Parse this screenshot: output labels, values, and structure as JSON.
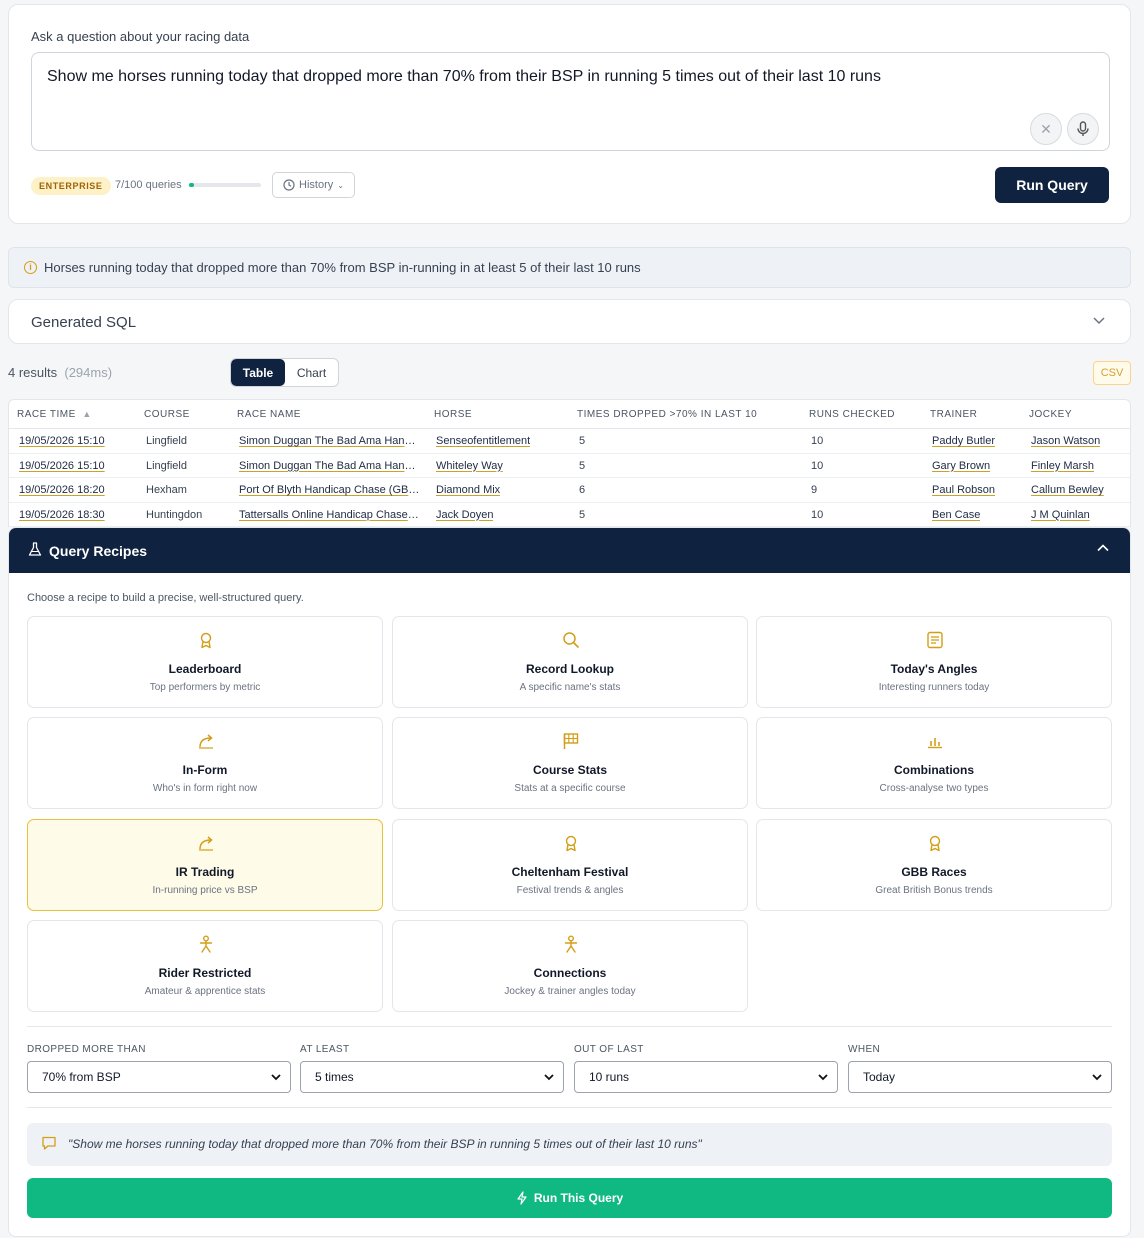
{
  "query": {
    "label": "Ask a question about your racing data",
    "text": "Show me horses running today that dropped more than 70% from their BSP in running 5 times out of their last 10 runs",
    "clear_icon": "close-icon",
    "mic_icon": "microphone-icon",
    "plan_badge": "ENTERPRISE",
    "usage": "7/100 queries",
    "usage_fraction": 0.07,
    "history_label": "History",
    "run_label": "Run Query"
  },
  "info": {
    "text": "Horses running today that dropped more than 70% from BSP in-running in at least 5 of their last 10 runs"
  },
  "sql": {
    "title": "Generated SQL"
  },
  "results": {
    "count": "4 results",
    "time": "(294ms)",
    "tab_table": "Table",
    "tab_chart": "Chart",
    "csv": "CSV",
    "columns": [
      "RACE TIME",
      "COURSE",
      "RACE NAME",
      "HORSE",
      "TIMES DROPPED >70% IN LAST 10",
      "RUNS CHECKED",
      "TRAINER",
      "JOCKEY"
    ],
    "sort_indicator": "▲",
    "rows": [
      [
        "19/05/2026 15:10",
        "Lingfield",
        "Simon Duggan The Bad Ama Handicap",
        "Senseofentitlement",
        "5",
        "10",
        "Paddy Butler",
        "Jason Watson"
      ],
      [
        "19/05/2026 15:10",
        "Lingfield",
        "Simon Duggan The Bad Ama Handicap",
        "Whiteley Way",
        "5",
        "10",
        "Gary Brown",
        "Finley Marsh"
      ],
      [
        "19/05/2026 18:20",
        "Hexham",
        "Port Of Blyth Handicap Chase (GBB Race)",
        "Diamond Mix",
        "6",
        "9",
        "Paul Robson",
        "Callum Bewley"
      ],
      [
        "19/05/2026 18:30",
        "Huntingdon",
        "Tattersalls Online Handicap Chase (GBB Race)",
        "Jack Doyen",
        "5",
        "10",
        "Ben Case",
        "J M Quinlan"
      ]
    ]
  },
  "recipes": {
    "title": "Query Recipes",
    "subtitle": "Choose a recipe to build a precise, well-structured query.",
    "items": [
      {
        "title": "Leaderboard",
        "subtitle": "Top performers by metric",
        "icon": "award-icon"
      },
      {
        "title": "Record Lookup",
        "subtitle": "A specific name's stats",
        "icon": "search-icon"
      },
      {
        "title": "Today's Angles",
        "subtitle": "Interesting runners today",
        "icon": "document-icon"
      },
      {
        "title": "In-Form",
        "subtitle": "Who's in form right now",
        "icon": "trend-arrow-icon"
      },
      {
        "title": "Course Stats",
        "subtitle": "Stats at a specific course",
        "icon": "flag-icon"
      },
      {
        "title": "Combinations",
        "subtitle": "Cross-analyse two types",
        "icon": "bar-chart-icon"
      },
      {
        "title": "IR Trading",
        "subtitle": "In-running price vs BSP",
        "icon": "trend-arrow-icon"
      },
      {
        "title": "Cheltenham Festival",
        "subtitle": "Festival trends & angles",
        "icon": "award-icon"
      },
      {
        "title": "GBB Races",
        "subtitle": "Great British Bonus trends",
        "icon": "award-icon"
      },
      {
        "title": "Rider Restricted",
        "subtitle": "Amateur & apprentice stats",
        "icon": "person-icon"
      },
      {
        "title": "Connections",
        "subtitle": "Jockey & trainer angles today",
        "icon": "person-icon"
      }
    ],
    "selected": "IR Trading",
    "filters": [
      {
        "label": "DROPPED MORE THAN",
        "value": "70% from BSP"
      },
      {
        "label": "AT LEAST",
        "value": "5 times"
      },
      {
        "label": "OUT OF LAST",
        "value": "10 runs"
      },
      {
        "label": "WHEN",
        "value": "Today"
      }
    ],
    "preview": "\"Show me horses running today that dropped more than 70% from their BSP in running 5 times out of their last 10 runs\"",
    "run_label": "Run This Query"
  },
  "colors": {
    "navy": "#0f2340",
    "accent_gold": "#d39e17",
    "success_green": "#10b981"
  }
}
